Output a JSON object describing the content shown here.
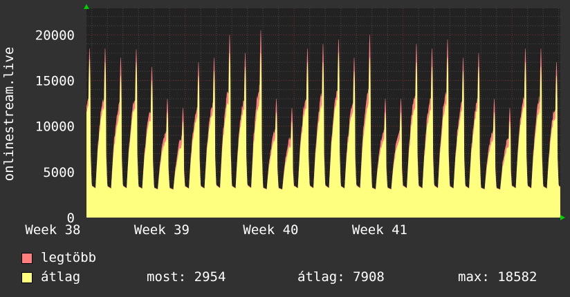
{
  "chart_data": {
    "type": "area",
    "ylabel": "onlinestream.live",
    "ylim": [
      0,
      22900
    ],
    "yticks": [
      "0",
      "5000",
      "10000",
      "15000",
      "20000"
    ],
    "ytick_values": [
      0,
      5000,
      10000,
      15000,
      20000
    ],
    "xtick_labels": [
      "Week 38",
      "Week 39",
      "Week 40",
      "Week 41"
    ],
    "grid": true,
    "days_shown": 30.4,
    "series": [
      {
        "name": "legtöbb",
        "color": "#ff7f7f",
        "daily_peaks": [
          18500,
          18500,
          17500,
          18400,
          16500,
          13000,
          12000,
          17000,
          17500,
          20000,
          18000,
          20500,
          13000,
          12000,
          18500,
          19000,
          19500,
          17500,
          20000,
          13000,
          13000,
          19000,
          18500,
          19500,
          17500,
          18000,
          13000,
          12000,
          18500,
          18500,
          17000,
          18500
        ]
      },
      {
        "name": "átlag",
        "color": "#ffff7f",
        "daily_peaks": [
          17300,
          17000,
          15500,
          17000,
          15000,
          11500,
          10500,
          15500,
          16000,
          18000,
          16500,
          18000,
          11500,
          10500,
          17000,
          17000,
          18000,
          16000,
          17500,
          11500,
          11500,
          17000,
          16500,
          17500,
          16000,
          16500,
          11500,
          10500,
          17000,
          16500,
          15500,
          17000
        ]
      }
    ]
  },
  "legend": {
    "items": [
      {
        "label": "legtöbb",
        "color": "#ff7f7f"
      },
      {
        "label": "átlag",
        "color": "#ffff7f"
      }
    ],
    "stats": {
      "most": "most: 2954",
      "atlag": "átlag: 7908",
      "max": "max: 18582"
    }
  }
}
